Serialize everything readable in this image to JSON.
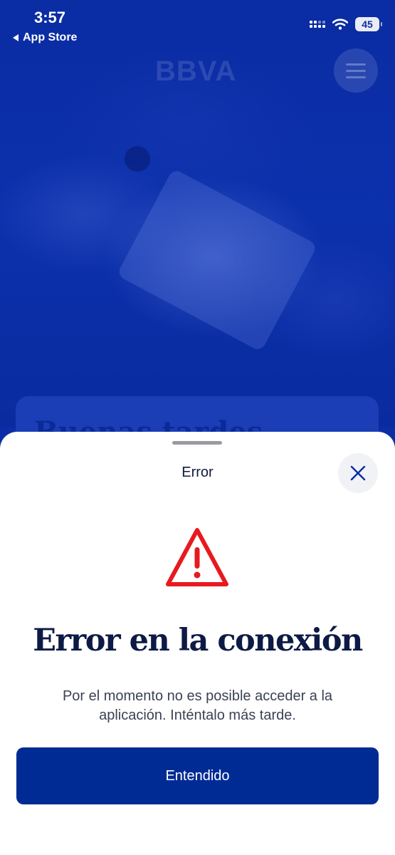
{
  "status_bar": {
    "time": "3:57",
    "back_label": "App Store",
    "battery": "45"
  },
  "background": {
    "brand": "BBVA",
    "card_title": "Buenas tardes"
  },
  "sheet": {
    "title": "Error",
    "headline": "Error en la conexión",
    "message": "Por el momento no es posible acceder a la aplicación. Inténtalo más tarde.",
    "button_label": "Entendido"
  },
  "colors": {
    "brand_blue": "#0b2ea6",
    "button_blue": "#002b95",
    "warning_red": "#e8191f",
    "headline_navy": "#0c1a45"
  },
  "icons": [
    "back-arrow-icon",
    "signal-icon",
    "wifi-icon",
    "battery-icon",
    "menu-icon",
    "close-icon",
    "warning-icon"
  ]
}
